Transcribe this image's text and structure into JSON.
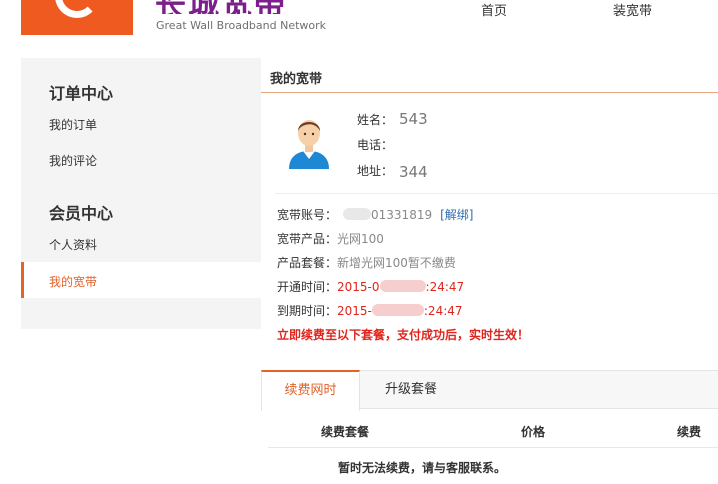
{
  "header": {
    "logo_cn": "长城宽带",
    "logo_en": "Great Wall Broadband Network",
    "nav": {
      "home": "首页",
      "install": "装宽带"
    }
  },
  "sidebar": {
    "order_center": {
      "title": "订单中心",
      "items": [
        "我的订单",
        "我的评论"
      ]
    },
    "member_center": {
      "title": "会员中心",
      "items": [
        "个人资料",
        "我的宽带"
      ]
    },
    "active_item": "我的宽带"
  },
  "main": {
    "title": "我的宽带",
    "profile": {
      "name_label": "姓名：",
      "name_value": "543",
      "phone_label": "电话：",
      "phone_value": "",
      "address_label": "地址：",
      "address_value": "344"
    },
    "details": {
      "account_label": "宽带账号：",
      "account_value": "01331819",
      "unbind_link": "[解绑]",
      "product_label": "宽带产品：",
      "product_value": "光网100",
      "package_label": "产品套餐：",
      "package_value": "新增光网100暂不缴费",
      "open_label": "开通时间：",
      "open_prefix": "2015-0",
      "open_suffix": ":24:47",
      "expire_label": "到期时间：",
      "expire_prefix": "2015-",
      "expire_suffix": ":24:47"
    },
    "notice": "立即续费至以下套餐，支付成功后，实时生效！",
    "tabs": [
      "续费网时",
      "升级套餐"
    ],
    "active_tab": "续费网时",
    "table": {
      "headers": [
        "续费套餐",
        "价格",
        "续费"
      ],
      "empty_message": "暂时无法续费，请与客服联系。"
    }
  },
  "colors": {
    "brand_orange": "#ee5a1f",
    "brand_purple": "#7b1f8a",
    "accent": "#e2622c",
    "alert_red": "#e0251e",
    "link_blue": "#2f6db3"
  }
}
